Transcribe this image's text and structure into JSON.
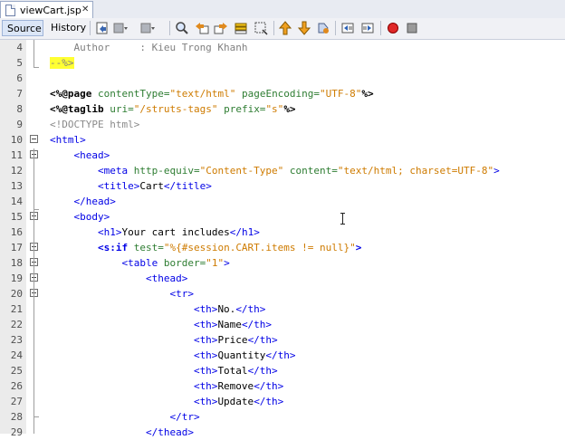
{
  "tab": {
    "filename": "viewCart.jsp",
    "close_glyph": "✕"
  },
  "toolbar": {
    "source_label": "Source",
    "history_label": "History",
    "icons": [
      "back-icon",
      "fwd-dropdown-icon",
      "back-dropdown-icon",
      "find-icon",
      "find-prev-icon",
      "find-next-icon",
      "toggle-highlight-icon",
      "toggle-rect-select-icon",
      "prev-bookmark-icon",
      "next-bookmark-icon",
      "toggle-bookmark-icon",
      "shift-left-icon",
      "shift-right-icon",
      "record-macro-icon",
      "stop-macro-icon"
    ]
  },
  "lines": [
    {
      "no": "4",
      "fold": false,
      "segments": [
        [
          "c-comment",
          "    Author     : Kieu Trong Khanh"
        ]
      ]
    },
    {
      "no": "5",
      "fold": false,
      "segments": [
        [
          "c-hl",
          "--%>"
        ]
      ]
    },
    {
      "no": "6",
      "fold": false,
      "segments": []
    },
    {
      "no": "7",
      "fold": false,
      "segments": [
        [
          "c-dir",
          "<%@page "
        ],
        [
          "c-attr",
          "contentType="
        ],
        [
          "c-val",
          "\"text/html\""
        ],
        [
          "c-attr",
          " pageEncoding="
        ],
        [
          "c-val",
          "\"UTF-8\""
        ],
        [
          "c-dir",
          "%>"
        ]
      ]
    },
    {
      "no": "8",
      "fold": false,
      "segments": [
        [
          "c-dir",
          "<%@taglib "
        ],
        [
          "c-attr",
          "uri="
        ],
        [
          "c-val",
          "\"/struts-tags\""
        ],
        [
          "c-attr",
          " prefix="
        ],
        [
          "c-val",
          "\"s\""
        ],
        [
          "c-dir",
          "%>"
        ]
      ]
    },
    {
      "no": "9",
      "fold": false,
      "segments": [
        [
          "c-doctype",
          "<!DOCTYPE html>"
        ]
      ]
    },
    {
      "no": "10",
      "fold": true,
      "segments": [
        [
          "c-tag",
          "<html>"
        ]
      ]
    },
    {
      "no": "11",
      "fold": true,
      "segments": [
        [
          "c-tag",
          "    <head>"
        ]
      ]
    },
    {
      "no": "12",
      "fold": false,
      "segments": [
        [
          "c-tag",
          "        <meta "
        ],
        [
          "c-attr",
          "http-equiv="
        ],
        [
          "c-val",
          "\"Content-Type\""
        ],
        [
          "c-attr",
          " content="
        ],
        [
          "c-val",
          "\"text/html; charset=UTF-8\""
        ],
        [
          "c-tag",
          ">"
        ]
      ]
    },
    {
      "no": "13",
      "fold": false,
      "segments": [
        [
          "c-tag",
          "        <title>"
        ],
        [
          "",
          "Cart"
        ],
        [
          "c-tag",
          "</title>"
        ]
      ]
    },
    {
      "no": "14",
      "fold": false,
      "segments": [
        [
          "c-tag",
          "    </head>"
        ]
      ]
    },
    {
      "no": "15",
      "fold": true,
      "segments": [
        [
          "c-tag",
          "    <body>"
        ]
      ]
    },
    {
      "no": "16",
      "fold": false,
      "segments": [
        [
          "c-tag",
          "        <h1>"
        ],
        [
          "",
          "Your cart includes"
        ],
        [
          "c-tag",
          "</h1>"
        ]
      ]
    },
    {
      "no": "17",
      "fold": true,
      "segments": [
        [
          "c-stag",
          "        <s:if "
        ],
        [
          "c-attr",
          "test="
        ],
        [
          "c-val",
          "\"%{#session.CART.items != null}\""
        ],
        [
          "c-stag",
          ">"
        ]
      ]
    },
    {
      "no": "18",
      "fold": true,
      "segments": [
        [
          "c-tag",
          "            <table "
        ],
        [
          "c-attr",
          "border="
        ],
        [
          "c-val",
          "\"1\""
        ],
        [
          "c-tag",
          ">"
        ]
      ]
    },
    {
      "no": "19",
      "fold": true,
      "segments": [
        [
          "c-tag",
          "                <thead>"
        ]
      ]
    },
    {
      "no": "20",
      "fold": true,
      "segments": [
        [
          "c-tag",
          "                    <tr>"
        ]
      ]
    },
    {
      "no": "21",
      "fold": false,
      "segments": [
        [
          "c-tag",
          "                        <th>"
        ],
        [
          "",
          "No."
        ],
        [
          "c-tag",
          "</th>"
        ]
      ]
    },
    {
      "no": "22",
      "fold": false,
      "segments": [
        [
          "c-tag",
          "                        <th>"
        ],
        [
          "",
          "Name"
        ],
        [
          "c-tag",
          "</th>"
        ]
      ]
    },
    {
      "no": "23",
      "fold": false,
      "segments": [
        [
          "c-tag",
          "                        <th>"
        ],
        [
          "",
          "Price"
        ],
        [
          "c-tag",
          "</th>"
        ]
      ]
    },
    {
      "no": "24",
      "fold": false,
      "segments": [
        [
          "c-tag",
          "                        <th>"
        ],
        [
          "",
          "Quantity"
        ],
        [
          "c-tag",
          "</th>"
        ]
      ]
    },
    {
      "no": "25",
      "fold": false,
      "segments": [
        [
          "c-tag",
          "                        <th>"
        ],
        [
          "",
          "Total"
        ],
        [
          "c-tag",
          "</th>"
        ]
      ]
    },
    {
      "no": "26",
      "fold": false,
      "segments": [
        [
          "c-tag",
          "                        <th>"
        ],
        [
          "",
          "Remove"
        ],
        [
          "c-tag",
          "</th>"
        ]
      ]
    },
    {
      "no": "27",
      "fold": false,
      "segments": [
        [
          "c-tag",
          "                        <th>"
        ],
        [
          "",
          "Update"
        ],
        [
          "c-tag",
          "</th>"
        ]
      ]
    },
    {
      "no": "28",
      "fold": false,
      "segments": [
        [
          "c-tag",
          "                    </tr>"
        ]
      ]
    },
    {
      "no": "29",
      "fold": false,
      "segments": [
        [
          "c-tag",
          "                </thead>"
        ]
      ]
    }
  ]
}
